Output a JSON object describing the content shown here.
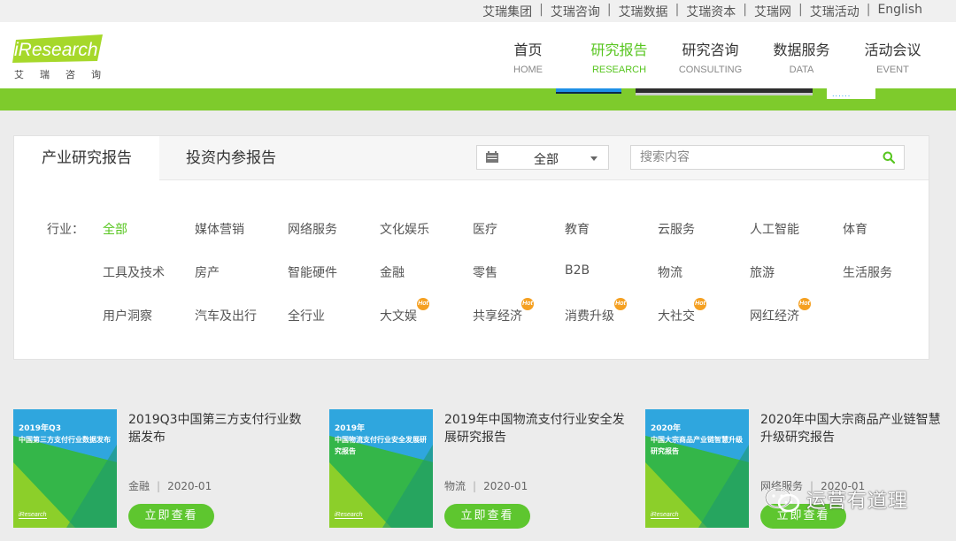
{
  "topbar": {
    "links": [
      "艾瑞集团",
      "艾瑞咨询",
      "艾瑞数据",
      "艾瑞资本",
      "艾瑞网",
      "艾瑞活动",
      "English"
    ]
  },
  "logo": {
    "brand": "iResearch",
    "subtitle": "艾瑞咨询"
  },
  "nav": [
    {
      "cn": "首页",
      "en": "HOME"
    },
    {
      "cn": "研究报告",
      "en": "RESEARCH"
    },
    {
      "cn": "研究咨询",
      "en": "CONSULTING"
    },
    {
      "cn": "数据服务",
      "en": "DATA"
    },
    {
      "cn": "活动会议",
      "en": "EVENT"
    }
  ],
  "nav_active": "研究报告",
  "banner": {
    "dots": "......"
  },
  "tabs": {
    "industry": "产业研究报告",
    "investment": "投资内参报告"
  },
  "select": {
    "value": "全部"
  },
  "search": {
    "placeholder": "搜索内容"
  },
  "industry": {
    "label": "行业：",
    "items": [
      "全部",
      "媒体营销",
      "网络服务",
      "文化娱乐",
      "医疗",
      "教育",
      "云服务",
      "人工智能",
      "体育",
      "工具及技术",
      "房产",
      "智能硬件",
      "金融",
      "零售",
      "B2B",
      "物流",
      "旅游",
      "生活服务",
      "用户洞察",
      "汽车及出行",
      "全行业",
      "大文娱",
      "共享经济",
      "消费升级",
      "大社交",
      "网红经济"
    ],
    "hot_badge": "Hot"
  },
  "reports": [
    {
      "thumb_year": "2019年Q3",
      "thumb_title": "中国第三方支付行业数据发布",
      "title": "2019Q3中国第三方支付行业数据发布",
      "category": "金融",
      "date": "2020-01",
      "button": "立即查看"
    },
    {
      "thumb_year": "2019年",
      "thumb_title": "中国物流支付行业安全发展研究报告",
      "title": "2019年中国物流支付行业安全发展研究报告",
      "category": "物流",
      "date": "2020-01",
      "button": "立即查看"
    },
    {
      "thumb_year": "2020年",
      "thumb_title": "中国大宗商品产业链智慧升级研究报告",
      "title": "2020年中国大宗商品产业链智慧升级研究报告",
      "category": "网络服务",
      "date": "2020-01",
      "button": "立即查看"
    }
  ],
  "thumb_logo": "iResearch",
  "watermark": "运营有道理",
  "colors": {
    "accent": "#57c51f",
    "banner": "#7ecb2c",
    "hot": "#f5a021",
    "button": "#5ec62f"
  }
}
